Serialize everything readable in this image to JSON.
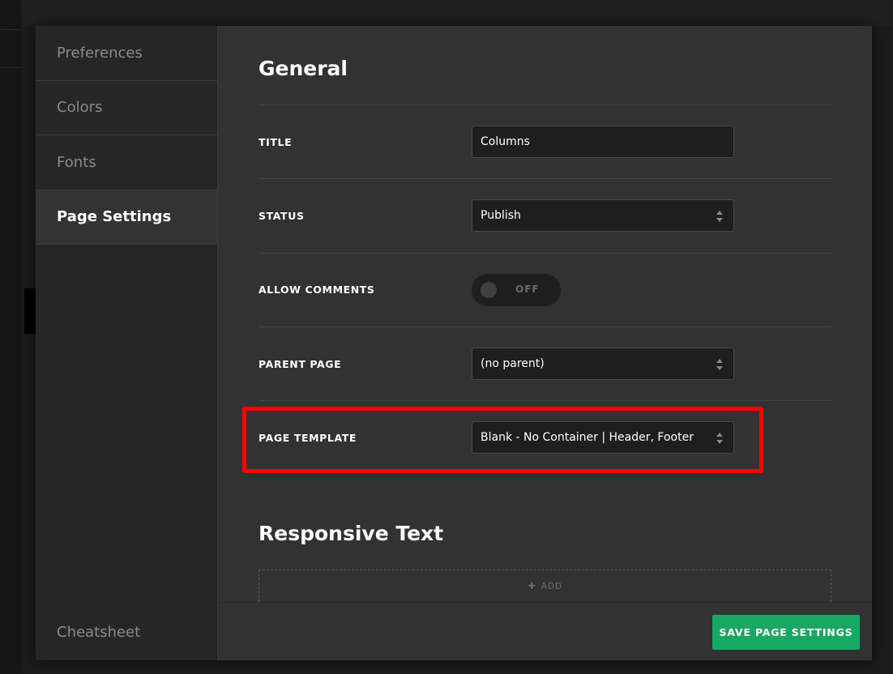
{
  "sidebar": {
    "items": [
      {
        "label": "Preferences"
      },
      {
        "label": "Colors"
      },
      {
        "label": "Fonts"
      },
      {
        "label": "Page Settings"
      }
    ],
    "bottom_item": "Cheatsheet"
  },
  "general": {
    "title": "General",
    "fields": {
      "title": {
        "label": "TITLE",
        "value": "Columns"
      },
      "status": {
        "label": "STATUS",
        "value": "Publish"
      },
      "allow_comments": {
        "label": "ALLOW COMMENTS",
        "value": "OFF"
      },
      "parent_page": {
        "label": "PARENT PAGE",
        "value": "(no parent)"
      },
      "page_template": {
        "label": "PAGE TEMPLATE",
        "value": "Blank - No Container | Header, Footer"
      }
    }
  },
  "responsive_text": {
    "title": "Responsive Text",
    "add_label": "ADD"
  },
  "footer": {
    "save_label": "SAVE PAGE SETTINGS"
  },
  "colors": {
    "accent_green": "#17a864",
    "highlight_red": "#ff0000",
    "panel_bg": "#323232",
    "sidebar_bg": "#262626"
  }
}
